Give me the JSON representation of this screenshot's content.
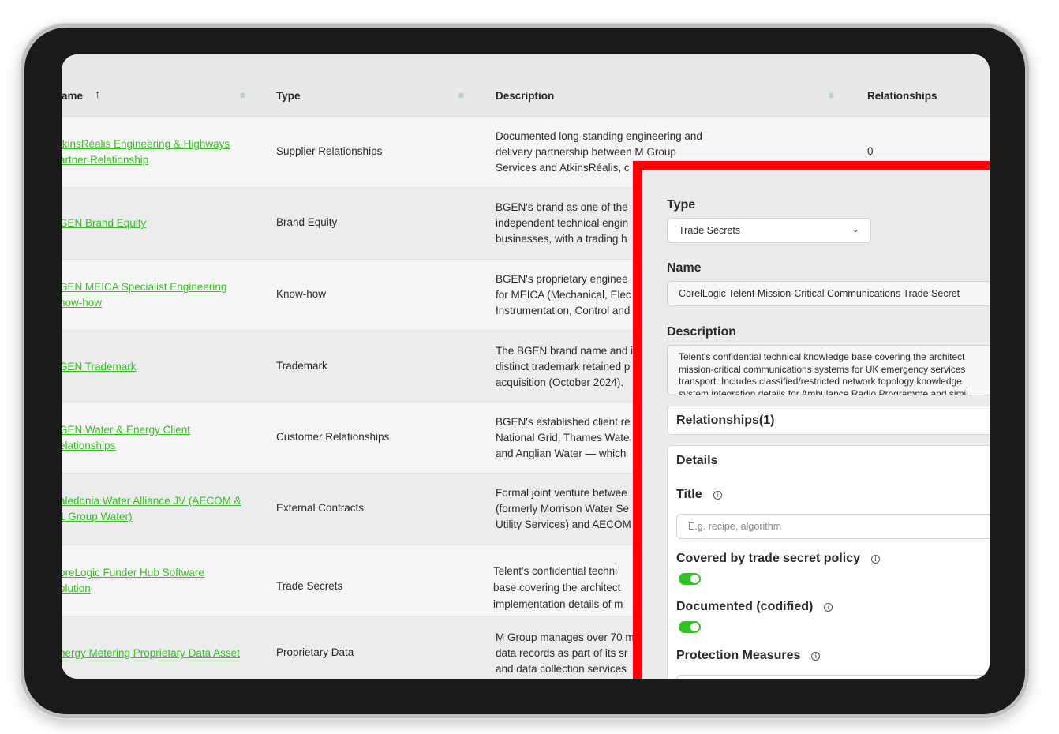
{
  "table": {
    "headers": {
      "name": "ame",
      "sort_arrow": "↑",
      "type": "Type",
      "description": "Description",
      "relationships": "Relationships"
    },
    "rows": [
      {
        "name": [
          "tkinsRéalis Engineering & Highways",
          "artner Relationship"
        ],
        "type": "Supplier Relationships",
        "desc": [
          "Documented long-standing engineering and",
          "delivery partnership between M Group",
          "Services and AtkinsRéalis, c"
        ],
        "rel": "0"
      },
      {
        "name": [
          "GEN Brand Equity"
        ],
        "type": "Brand Equity",
        "desc": [
          "BGEN's brand as one of the",
          "independent technical engin",
          "businesses, with a trading h"
        ],
        "rel": ""
      },
      {
        "name": [
          "GEN MEICA Specialist Engineering",
          "now-how"
        ],
        "type": "Know-how",
        "desc": [
          "BGEN's proprietary enginee",
          "for MEICA (Mechanical, Elec",
          "Instrumentation, Control and"
        ],
        "rel": ""
      },
      {
        "name": [
          "GEN Trademark"
        ],
        "type": "Trademark",
        "desc": [
          "The BGEN brand name and i",
          "distinct trademark retained p",
          "acquisition (October 2024)."
        ],
        "rel": ""
      },
      {
        "name": [
          "GEN Water & Energy Client",
          "elationships"
        ],
        "type": "Customer Relationships",
        "desc": [
          "BGEN's established client re",
          "National Grid, Thames Wate",
          "and Anglian Water — which"
        ],
        "rel": ""
      },
      {
        "name": [
          "aledonia Water Alliance JV (AECOM &",
          "1 Group Water)"
        ],
        "type": "External Contracts",
        "desc": [
          "Formal joint venture betwee",
          "(formerly Morrison Water Se",
          "Utility Services) and AECOM"
        ],
        "rel": ""
      },
      {
        "name": [
          "oreLogic Funder Hub Software",
          "olution"
        ],
        "type": "Trade Secrets",
        "desc": [
          "Telent's confidential techni",
          "base covering the architect",
          "implementation details of m"
        ],
        "rel": ""
      },
      {
        "name": [
          "nergy Metering Proprietary Data Asset"
        ],
        "type": "Proprietary Data",
        "desc": [
          "M Group manages over 70 m",
          "data records as part of its sr",
          "and data collection services"
        ],
        "rel": ""
      }
    ]
  },
  "panel": {
    "type_label": "Type",
    "type_value": "Trade Secrets",
    "chevron_icon": "chevron-down-icon",
    "name_label": "Name",
    "name_value": "CorelLogic Telent Mission-Critical Communications Trade Secret",
    "description_label": "Description",
    "description_lines": [
      "Telent's confidential technical knowledge base covering the architect",
      "mission-critical communications systems for UK emergency services",
      "transport. Includes classified/restricted network topology knowledge",
      "system integration details for Ambulance Radio Programme and simil"
    ],
    "relationships_label": "Relationships(1)",
    "details_label": "Details",
    "title_label": "Title",
    "title_placeholder": "E.g. recipe, algorithm",
    "covered_label": "Covered by trade secret policy",
    "covered_on": true,
    "documented_label": "Documented (codified)",
    "documented_on": true,
    "protection_label": "Protection Measures",
    "info_icon": "info-icon",
    "info_glyph": "i"
  },
  "colors": {
    "accent_green": "#3bbf26",
    "toggle_green": "#33c224",
    "highlight_red": "#ff0000"
  }
}
